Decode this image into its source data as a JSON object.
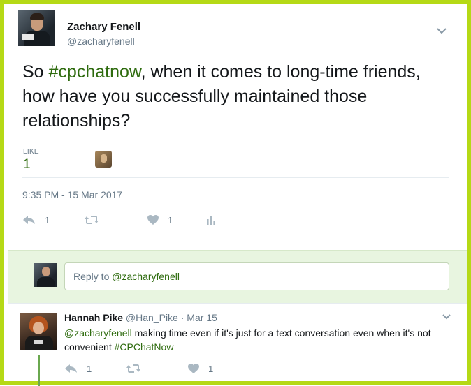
{
  "author": {
    "name": "Zachary Fenell",
    "handle": "@zacharyfenell"
  },
  "tweet": {
    "text_prefix": "So ",
    "hashtag": "#cpchatnow",
    "text_suffix": ", when it comes to long-time friends, how have you successfully maintained those relationships?",
    "like_label": "LIKE",
    "like_count": "1",
    "timestamp": "9:35 PM - 15 Mar 2017",
    "actions": {
      "reply_count": "1",
      "retweet_count": "",
      "like_count": "1"
    }
  },
  "reply_box": {
    "prefix": "Reply to ",
    "mention": "@zacharyfenell"
  },
  "reply": {
    "name": "Hannah Pike",
    "handle": "@Han_Pike",
    "separator": " · ",
    "date": "Mar 15",
    "mention": "@zacharyfenell",
    "text": " making time even if it's just for a text conversation even when it's not convenient ",
    "hashtag": "#CPChatNow",
    "actions": {
      "reply_count": "1",
      "retweet_count": "",
      "like_count": "1"
    }
  },
  "colors": {
    "frame_border": "#b5d916",
    "link_green": "#2e6b0e",
    "reply_bg": "#e8f5e0",
    "thread_line": "#6aa84f",
    "muted": "#657786",
    "icon": "#aab8c2"
  },
  "icons": {
    "chevron": "chevron-down-icon",
    "reply": "reply-icon",
    "retweet": "retweet-icon",
    "like": "heart-icon",
    "analytics": "analytics-icon"
  }
}
